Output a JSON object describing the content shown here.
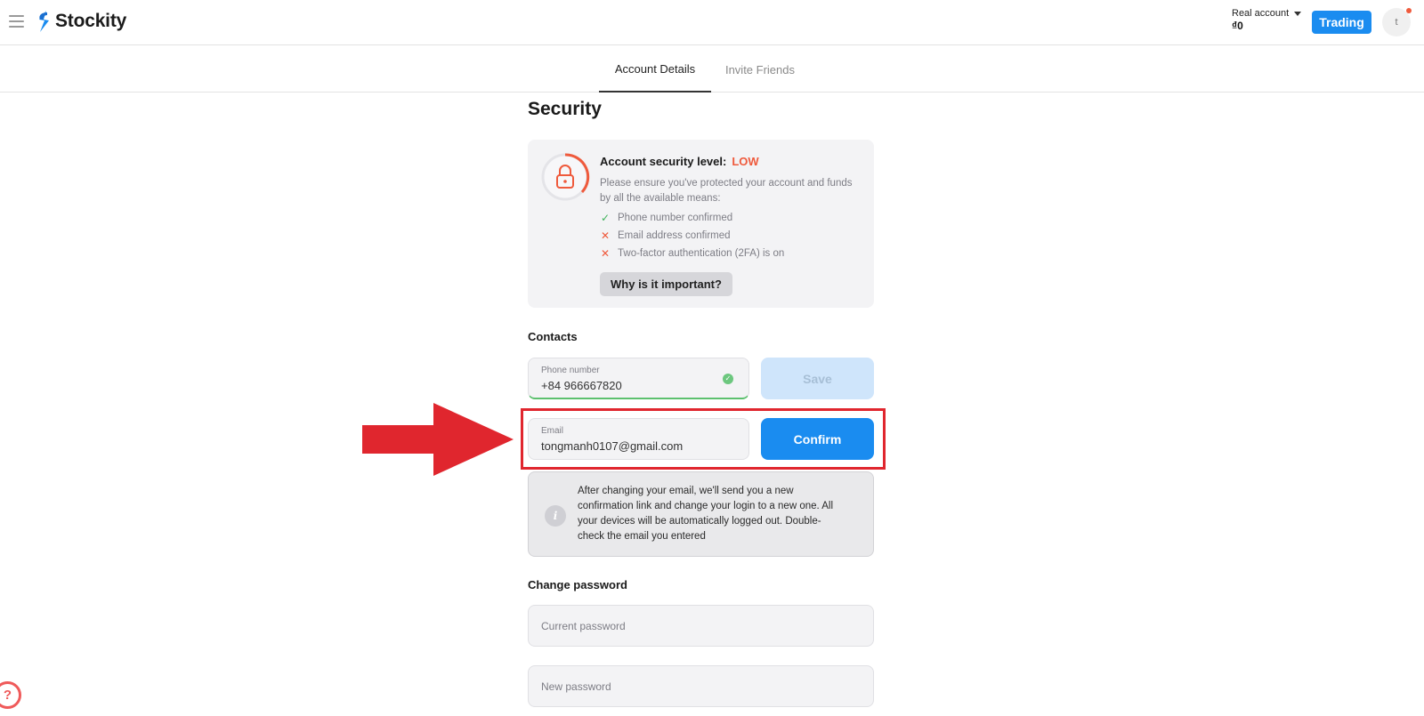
{
  "header": {
    "brand": "Stockity",
    "account_type": "Real account",
    "balance": "₫0",
    "trading_label": "Trading",
    "avatar_initial": "t"
  },
  "tabs": [
    {
      "label": "Account Details",
      "active": true
    },
    {
      "label": "Invite Friends",
      "active": false
    }
  ],
  "page_title": "Security",
  "security_card": {
    "heading": "Account security level:",
    "level": "LOW",
    "level_color": "#ef5a3c",
    "description": "Please ensure you've protected your account and funds by all the available means:",
    "checks": [
      {
        "label": "Phone number confirmed",
        "status": "done",
        "icon": "check-icon"
      },
      {
        "label": "Email address confirmed",
        "status": "missing",
        "icon": "cross-icon"
      },
      {
        "label": "Two-factor authentication (2FA) is on",
        "status": "missing",
        "icon": "cross-icon"
      }
    ],
    "why_button": "Why is it important?"
  },
  "contacts": {
    "section_label": "Contacts",
    "phone": {
      "label": "Phone number",
      "value": "+84 966667820",
      "verified": true
    },
    "save_label": "Save",
    "email": {
      "label": "Email",
      "value": "tongmanh0107@gmail.com"
    },
    "confirm_label": "Confirm",
    "info_text": "After changing your email, we'll send you a new confirmation link and change your login to a new one. All your devices will be automatically logged out. Double-check the email you entered"
  },
  "change_password": {
    "section_label": "Change password",
    "current_placeholder": "Current password",
    "new_placeholder": "New password"
  },
  "colors": {
    "accent": "#1a8cf0",
    "annotation": "#e0262e"
  }
}
